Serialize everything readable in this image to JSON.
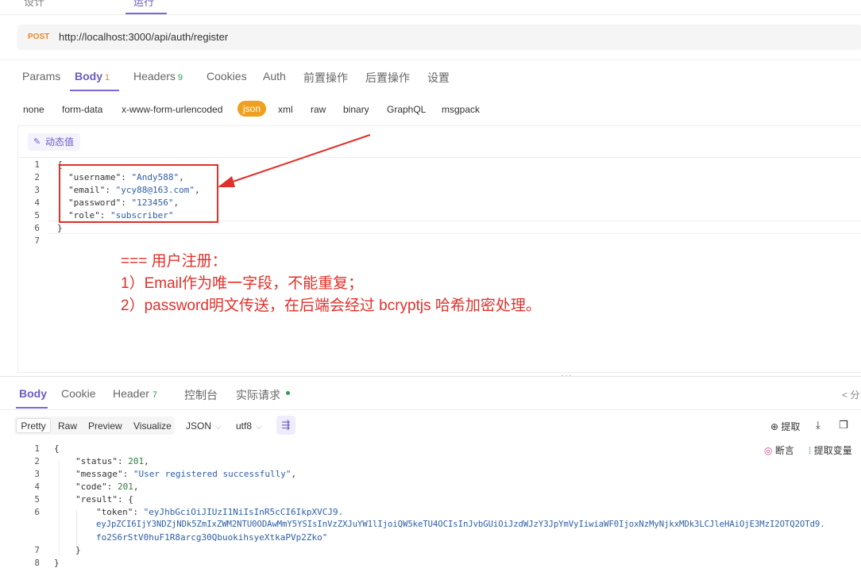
{
  "top_tabs": [
    "设计",
    "",
    "运行"
  ],
  "request": {
    "method": "POST",
    "url": "http://localhost:3000/api/auth/register"
  },
  "request_tabs": [
    {
      "label": "Params"
    },
    {
      "label": "Body",
      "badge": "1"
    },
    {
      "label": "Headers",
      "badge": "9"
    },
    {
      "label": "Cookies"
    },
    {
      "label": "Auth"
    },
    {
      "label": "前置操作"
    },
    {
      "label": "后置操作"
    },
    {
      "label": "设置"
    }
  ],
  "body_types": [
    "none",
    "form-data",
    "x-www-form-urlencoded",
    "json",
    "xml",
    "raw",
    "binary",
    "GraphQL",
    "msgpack"
  ],
  "dynamic_value_label": "动态值",
  "request_body_lines": [
    "1",
    "2",
    "3",
    "4",
    "5",
    "6",
    "7"
  ],
  "request_body": {
    "open": "{",
    "username_key": "\"username\"",
    "username_val": "\"Andy588\"",
    "email_key": "\"email\"",
    "email_val": "\"ycy88@163.com\"",
    "password_key": "\"password\"",
    "password_val": "\"123456\"",
    "role_key": "\"role\"",
    "role_val": "\"subscriber\"",
    "close": "}"
  },
  "annotation": {
    "line1": "=== 用户注册：",
    "line2": "1）Email作为唯一字段，不能重复；",
    "line3": "2）password明文传送，在后端会经过 bcryptjs 哈希加密处理。"
  },
  "response_tabs": [
    {
      "label": "Body"
    },
    {
      "label": "Cookie"
    },
    {
      "label": "Header",
      "badge": "7"
    },
    {
      "label": "控制台"
    },
    {
      "label": "实际请求"
    }
  ],
  "view_modes": [
    "Pretty",
    "Raw",
    "Preview",
    "Visualize"
  ],
  "format_select": "JSON",
  "encoding_select": "utf8",
  "tools": {
    "extract": "提取",
    "assert": "断言",
    "extract_var": "提取变量"
  },
  "response_lines": [
    "1",
    "2",
    "3",
    "4",
    "5",
    "6",
    "",
    "",
    "7",
    "8"
  ],
  "response_body": {
    "open": "{",
    "status_key": "\"status\"",
    "status_val": "201",
    "message_key": "\"message\"",
    "message_val": "\"User registered successfully\"",
    "code_key": "\"code\"",
    "code_val": "201",
    "result_key": "\"result\"",
    "token_key": "\"token\"",
    "token_line1": "\"eyJhbGciOiJIUzI1NiIsInR5cCI6IkpXVCJ9.",
    "token_line2": "eyJpZCI6IjY3NDZjNDk5ZmIxZWM2NTU0ODAwMmY5YSIsInVzZXJuYW1lIjoiQW5keTU4OCIsInJvbGUiOiJzdWJzY3JpYmVyIiwiaWF0IjoxNzMyNjkxMDk3LCJleHAiOjE3MzI2OTQ2OTd9.",
    "token_line3": "fo2S6rStV0huF1R8arcg30QbuokihsyeXtkaPVp2Zko\"",
    "close_inner": "}",
    "close": "}"
  },
  "colors": {
    "accent": "#6a5cc7",
    "method": "#e8862a",
    "annotation": "#e0302a",
    "json_pill": "#f0a020",
    "string": "#2d5da8",
    "number": "#2f7a3b"
  }
}
